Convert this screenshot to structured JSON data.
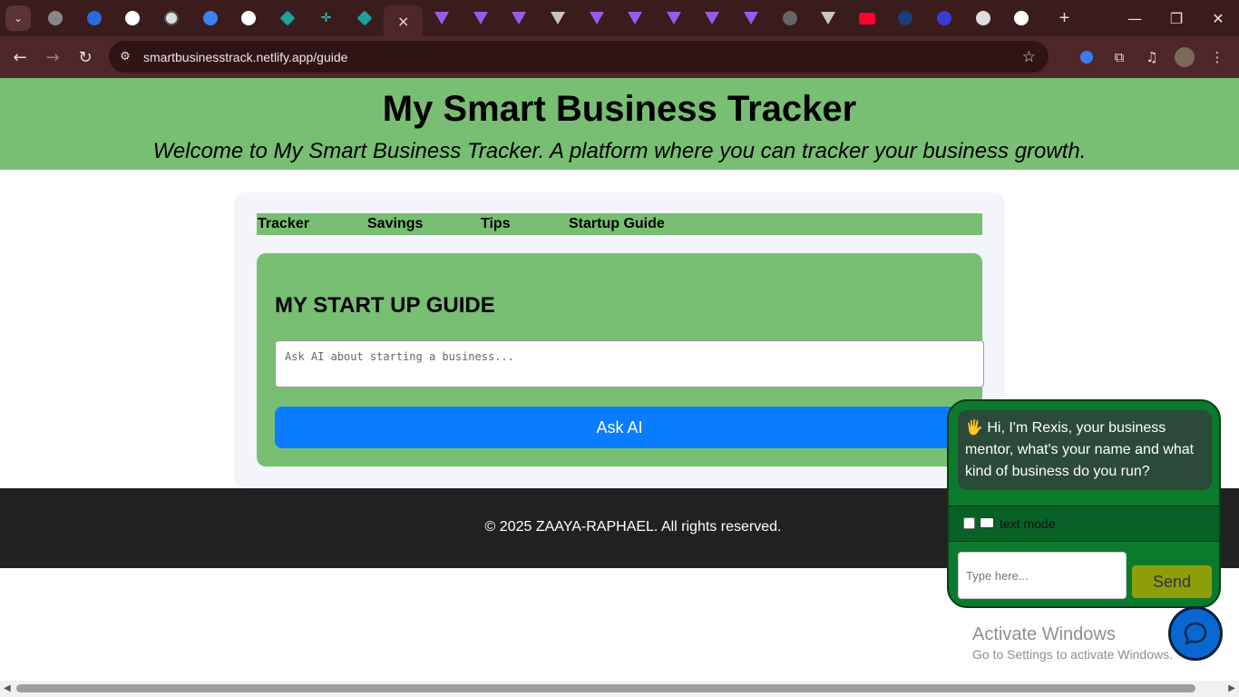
{
  "browser": {
    "tab_count_icons": [
      "globe-icon",
      "kora-icon",
      "github-icon",
      "openai-icon",
      "react-icon",
      "github-icon",
      "diamond-icon",
      "crosshair-icon",
      "diamond-icon"
    ],
    "active_tab_close": "×",
    "url": "smartbusinesstrack.netlify.app/guide",
    "new_tab": "+",
    "window_controls": {
      "minimize": "—",
      "maximize": "❐",
      "close": "✕"
    }
  },
  "header": {
    "title": "My Smart Business Tracker",
    "subtitle": "Welcome to My Smart Business Tracker. A platform where you can tracker your business growth."
  },
  "nav": {
    "tracker": "Tracker",
    "savings": "Savings",
    "tips": "Tips",
    "guide": "Startup Guide"
  },
  "guide": {
    "title": "MY START UP GUIDE",
    "placeholder": "Ask AI about starting a business...",
    "ask_button": "Ask AI"
  },
  "footer": {
    "copyright": "© 2025 ZAAYA-RAPHAEL. All rights reserved."
  },
  "chat": {
    "greeting": "🖐 Hi, I'm Rexis, your business mentor, what's your name and what kind of business do you run?",
    "mode_label": "text mode",
    "input_placeholder": "Type here...",
    "send_label": "Send"
  },
  "os_overlay": {
    "line1": "Activate Windows",
    "line2": "Go to Settings to activate Windows."
  },
  "colors": {
    "header_green": "#78bf74",
    "ask_blue": "#0a7cff",
    "footer_dark": "#212121",
    "chat_green": "#0b7a2c",
    "send_olive": "#8d9e0a"
  }
}
